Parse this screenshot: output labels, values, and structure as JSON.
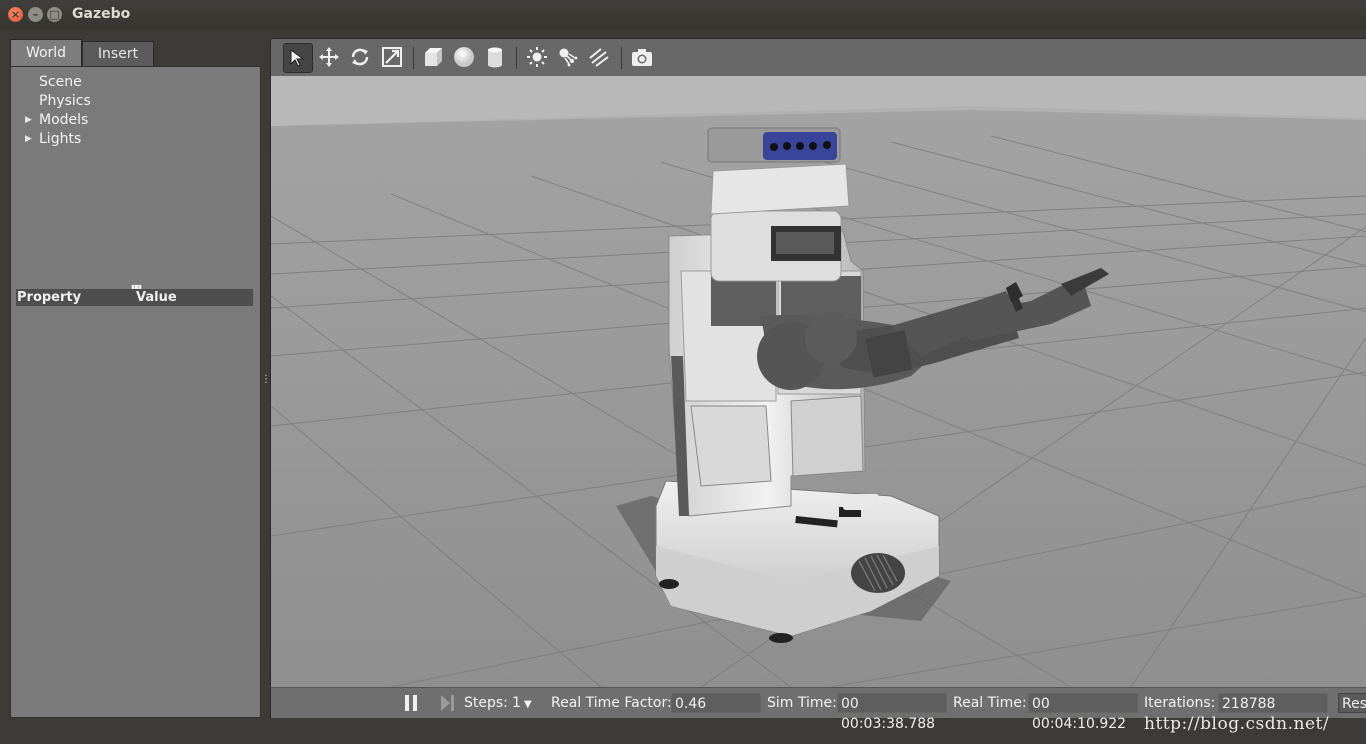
{
  "window": {
    "title": "Gazebo"
  },
  "left_panel": {
    "tabs": [
      "World",
      "Insert"
    ],
    "tree": [
      "Scene",
      "Physics",
      "Models",
      "Lights"
    ],
    "property_header": {
      "property": "Property",
      "value": "Value"
    }
  },
  "toolbar": {
    "tools": [
      "select-arrow-icon",
      "translate-icon",
      "rotate-icon",
      "scale-icon",
      "box-icon",
      "sphere-icon",
      "cylinder-icon",
      "point-light-icon",
      "spot-light-icon",
      "directional-light-icon",
      "screenshot-icon"
    ]
  },
  "bottom_bar": {
    "steps_label": "Steps:",
    "steps_value": "1",
    "rtf_label": "Real Time Factor:",
    "rtf_value": "0.46",
    "sim_time_label": "Sim Time:",
    "sim_time_value": "00 00:03:38.788",
    "real_time_label": "Real Time:",
    "real_time_value": "00 00:04:10.922",
    "iterations_label": "Iterations:",
    "iterations_value": "218788",
    "reset_label": "Res"
  },
  "watermark": "http://blog.csdn.net/"
}
